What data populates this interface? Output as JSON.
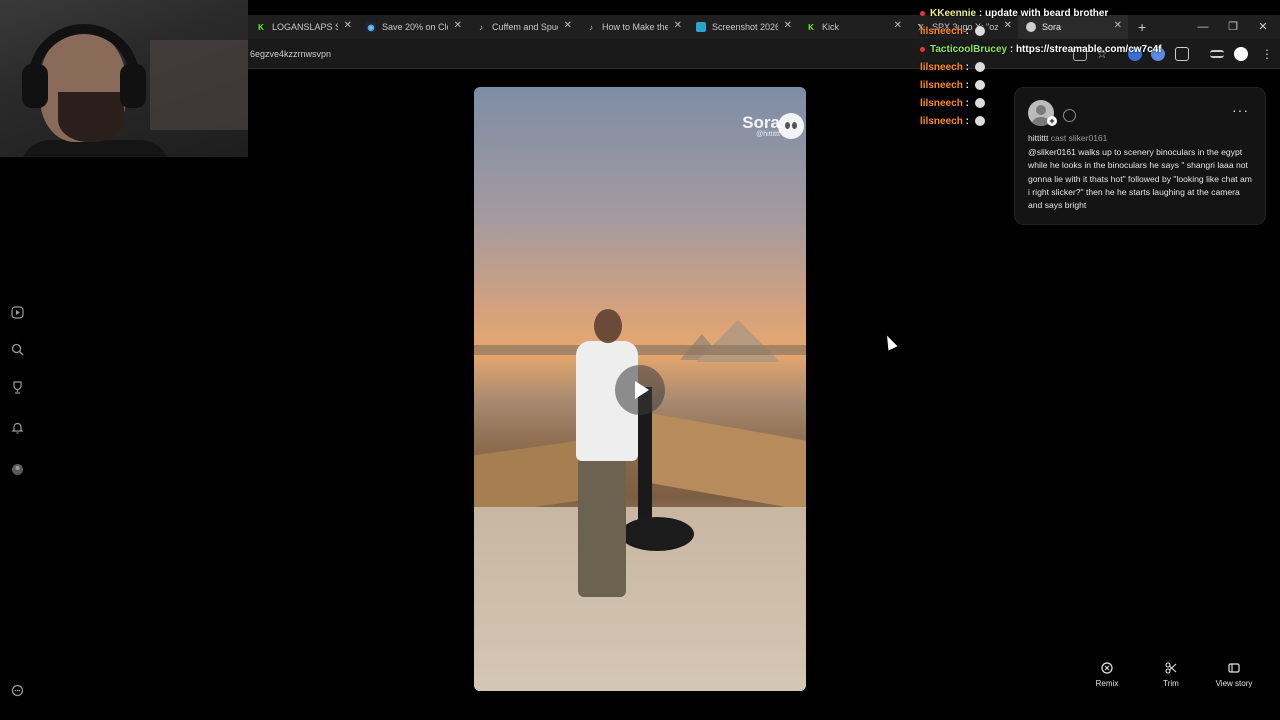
{
  "browser": {
    "tabs": [
      {
        "label": "LOGANSLAPS Str",
        "icon": "kick-icon",
        "color": "#53fc18"
      },
      {
        "label": "Save 20% on Clo",
        "icon": "steam-icon",
        "color": "#66c0f4"
      },
      {
        "label": "Cuffem and Spud",
        "icon": "tiktok-icon",
        "color": "#ffffff"
      },
      {
        "label": "How to Make the",
        "icon": "tiktok-icon",
        "color": "#ffffff"
      },
      {
        "label": "Screenshot 2026",
        "icon": "image-icon",
        "color": "#2aa4c9"
      },
      {
        "label": "Kick",
        "icon": "kick-icon",
        "color": "#53fc18"
      },
      {
        "label": "SPX 3ugo X: \"ozw",
        "icon": "x-icon",
        "color": "#ffffff"
      },
      {
        "label": "Sora",
        "icon": "sora-icon",
        "color": "#cccccc"
      }
    ],
    "url": "6egzve4kzzrnwsvpn"
  },
  "chat": [
    {
      "user": "KKeennie",
      "message": "update with beard brother",
      "color": "#e8f08a",
      "dot": true,
      "emote": false
    },
    {
      "user": "lilsneech",
      "message": "",
      "color": "#ff8a1c",
      "dot": false,
      "emote": true
    },
    {
      "user": "TacticoolBrucey",
      "message": "https://streamable.com/cw7c4f",
      "color": "#8de35a",
      "dot": true,
      "emote": false
    },
    {
      "user": "lilsneech",
      "message": "",
      "color": "#ff8a1c",
      "dot": false,
      "emote": true
    },
    {
      "user": "lilsneech",
      "message": "",
      "color": "#ff8a1c",
      "dot": false,
      "emote": true
    },
    {
      "user": "lilsneech",
      "message": "",
      "color": "#ff8a1c",
      "dot": false,
      "emote": true
    },
    {
      "user": "lilsneech",
      "message": "",
      "color": "#ff8a1c",
      "dot": false,
      "emote": true
    }
  ],
  "video": {
    "brand": "Sora",
    "handle": "@hittittt"
  },
  "card": {
    "author": "hittittt",
    "meta_rest": "cast sliker0161",
    "prompt": "@sliker0161 walks up to scenery binoculars in the egypt while he looks in the binoculars he says \" shangri laaa not gonna lie with it thats hot\" followed by \"looking like chat am i right slicker?\" then he he starts laughing at the camera and says bright",
    "more_label": "···"
  },
  "actions": [
    {
      "label": "Remix",
      "icon": "remix-icon"
    },
    {
      "label": "Trim",
      "icon": "scissors-icon"
    },
    {
      "label": "View story",
      "icon": "story-icon"
    }
  ],
  "sidebar": [
    "play-icon",
    "search-icon",
    "trophy-icon",
    "bell-icon",
    "profile-icon"
  ],
  "colors": {
    "background": "#000000",
    "card": "#141414"
  }
}
